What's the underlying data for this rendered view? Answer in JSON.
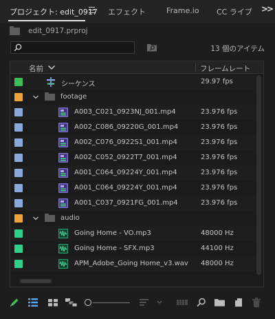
{
  "tabs": {
    "project": "プロジェクト: edit_0917",
    "effects": "エフェクト",
    "frameio": "Frame.io",
    "cc_libraries": "CC ライブ",
    "overflow": ">>"
  },
  "project": {
    "filename": "edit_0917.prproj",
    "search_value": "",
    "item_count": "13 個のアイテム"
  },
  "columns": {
    "name": "名前",
    "frame_rate": "フレームレート"
  },
  "rows": [
    {
      "name": "シーケンス",
      "fps": "29.97 fps",
      "type": "sequence",
      "label_color": "#3dbd58"
    },
    {
      "name": "footage",
      "fps": "",
      "type": "bin",
      "label_color": "#f0a03a"
    },
    {
      "name": "A003_C021_0923NJ_001.mp4",
      "fps": "23.976 fps",
      "type": "video",
      "label_color": "#8aa7de"
    },
    {
      "name": "A002_C086_09220G_001.mp4",
      "fps": "23.976 fps",
      "type": "video",
      "label_color": "#8aa7de"
    },
    {
      "name": "A002_C076_0922S1_001.mp4",
      "fps": "23.976 fps",
      "type": "video",
      "label_color": "#8aa7de"
    },
    {
      "name": "A002_C052_0922T7_001.mp4",
      "fps": "23.976 fps",
      "type": "video",
      "label_color": "#8aa7de"
    },
    {
      "name": "A001_C064_09224Y_001.mp4",
      "fps": "23.976 fps",
      "type": "video",
      "label_color": "#8aa7de"
    },
    {
      "name": "A001_C064_09224Y_001.mp4",
      "fps": "23.976 fps",
      "type": "video",
      "label_color": "#8aa7de"
    },
    {
      "name": "A001_C037_0921FG_001.mp4",
      "fps": "23.976 fps",
      "type": "video",
      "label_color": "#8aa7de"
    },
    {
      "name": "audio",
      "fps": "",
      "type": "bin",
      "label_color": "#f0a03a"
    },
    {
      "name": "Going Home - VO.mp3",
      "fps": "48000 Hz",
      "type": "audio",
      "label_color": "#2fd08a"
    },
    {
      "name": "Going Home - SFX.mp3",
      "fps": "44100 Hz",
      "type": "audio",
      "label_color": "#2fd08a"
    },
    {
      "name": "APM_Adobe_Going Home_v3.wav",
      "fps": "48000 Hz",
      "type": "audio",
      "label_color": "#2fd08a"
    }
  ],
  "toolbar_icons": [
    "pencil-icon",
    "list-view-icon",
    "icon-view-icon",
    "freeform-view-icon",
    "zoom-slider",
    "sort-icons",
    "automate-to-sequence-icon",
    "find-icon",
    "new-bin-icon",
    "new-item-icon",
    "clear-icon"
  ],
  "colors": {
    "accent_green": "#2fd08a",
    "bin_orange": "#f0a03a",
    "video_blue": "#8aa7de",
    "pencil_green": "#3dbd58"
  }
}
